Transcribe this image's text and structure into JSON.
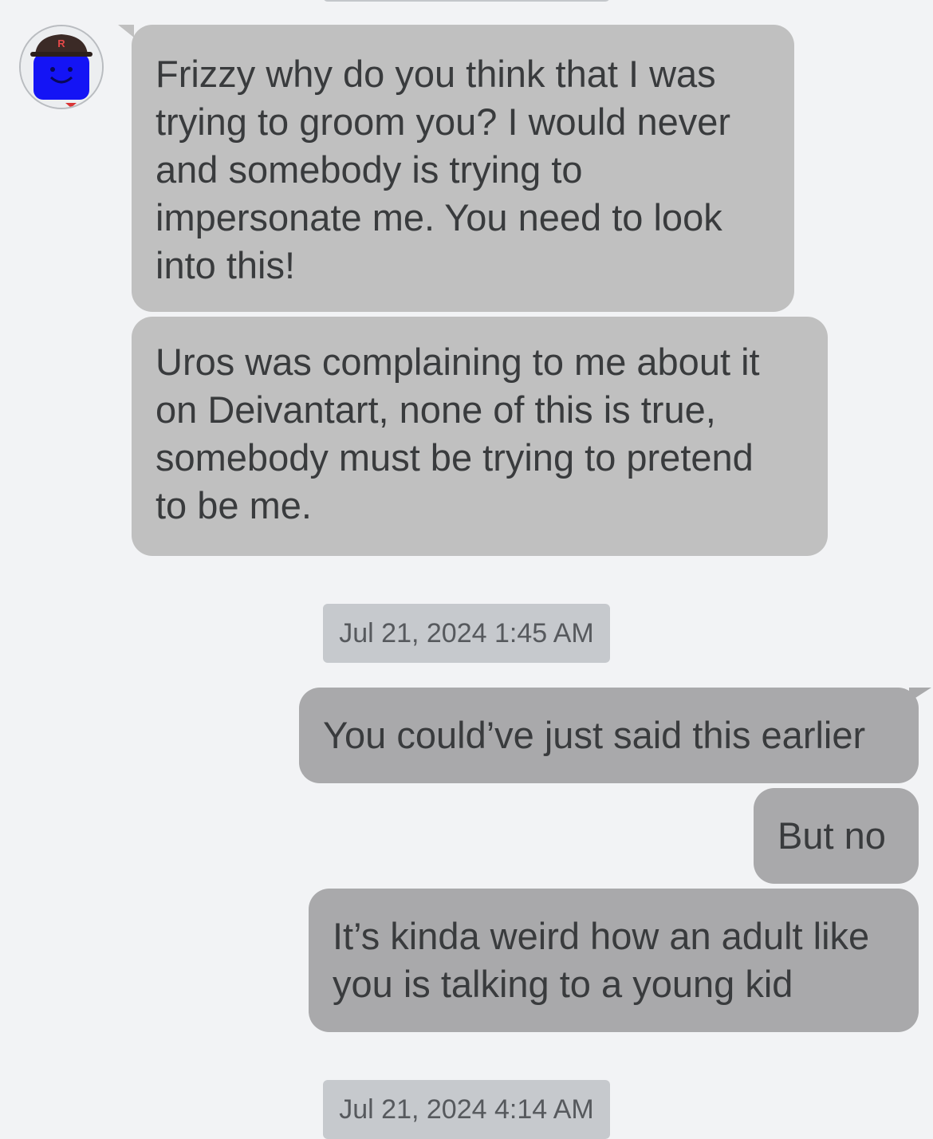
{
  "messages": [
    {
      "direction": "incoming",
      "text": "Frizzy why do you think that I was\ntrying to groom you? I would never\nand somebody is trying to\nimpersonate me. You need to look\ninto this!"
    },
    {
      "direction": "incoming",
      "text": "Uros was complaining to me about it\non Deivantart, none of this is true,\nsomebody must be trying to pretend\nto be me."
    },
    {
      "direction": "outgoing",
      "text": "You could’ve just said this earlier"
    },
    {
      "direction": "outgoing",
      "text": "But no"
    },
    {
      "direction": "outgoing",
      "text": "It’s kinda weird how an adult like\nyou is talking to a young kid"
    }
  ],
  "timestamps": [
    "Jul 21, 2024 1:45 AM",
    "Jul 21, 2024 4:14 AM"
  ],
  "avatar": {
    "icon": "blue-avatar-with-cap-icon",
    "cap_letter": "R",
    "face_color": "#1414f5",
    "cap_color": "#3b2a26"
  },
  "colors": {
    "background": "#f2f3f5",
    "incoming_bubble": "#c0c0c0",
    "outgoing_bubble": "#a9a9ab",
    "timestamp_pill": "#c6c9cd",
    "text": "#393b3d"
  }
}
